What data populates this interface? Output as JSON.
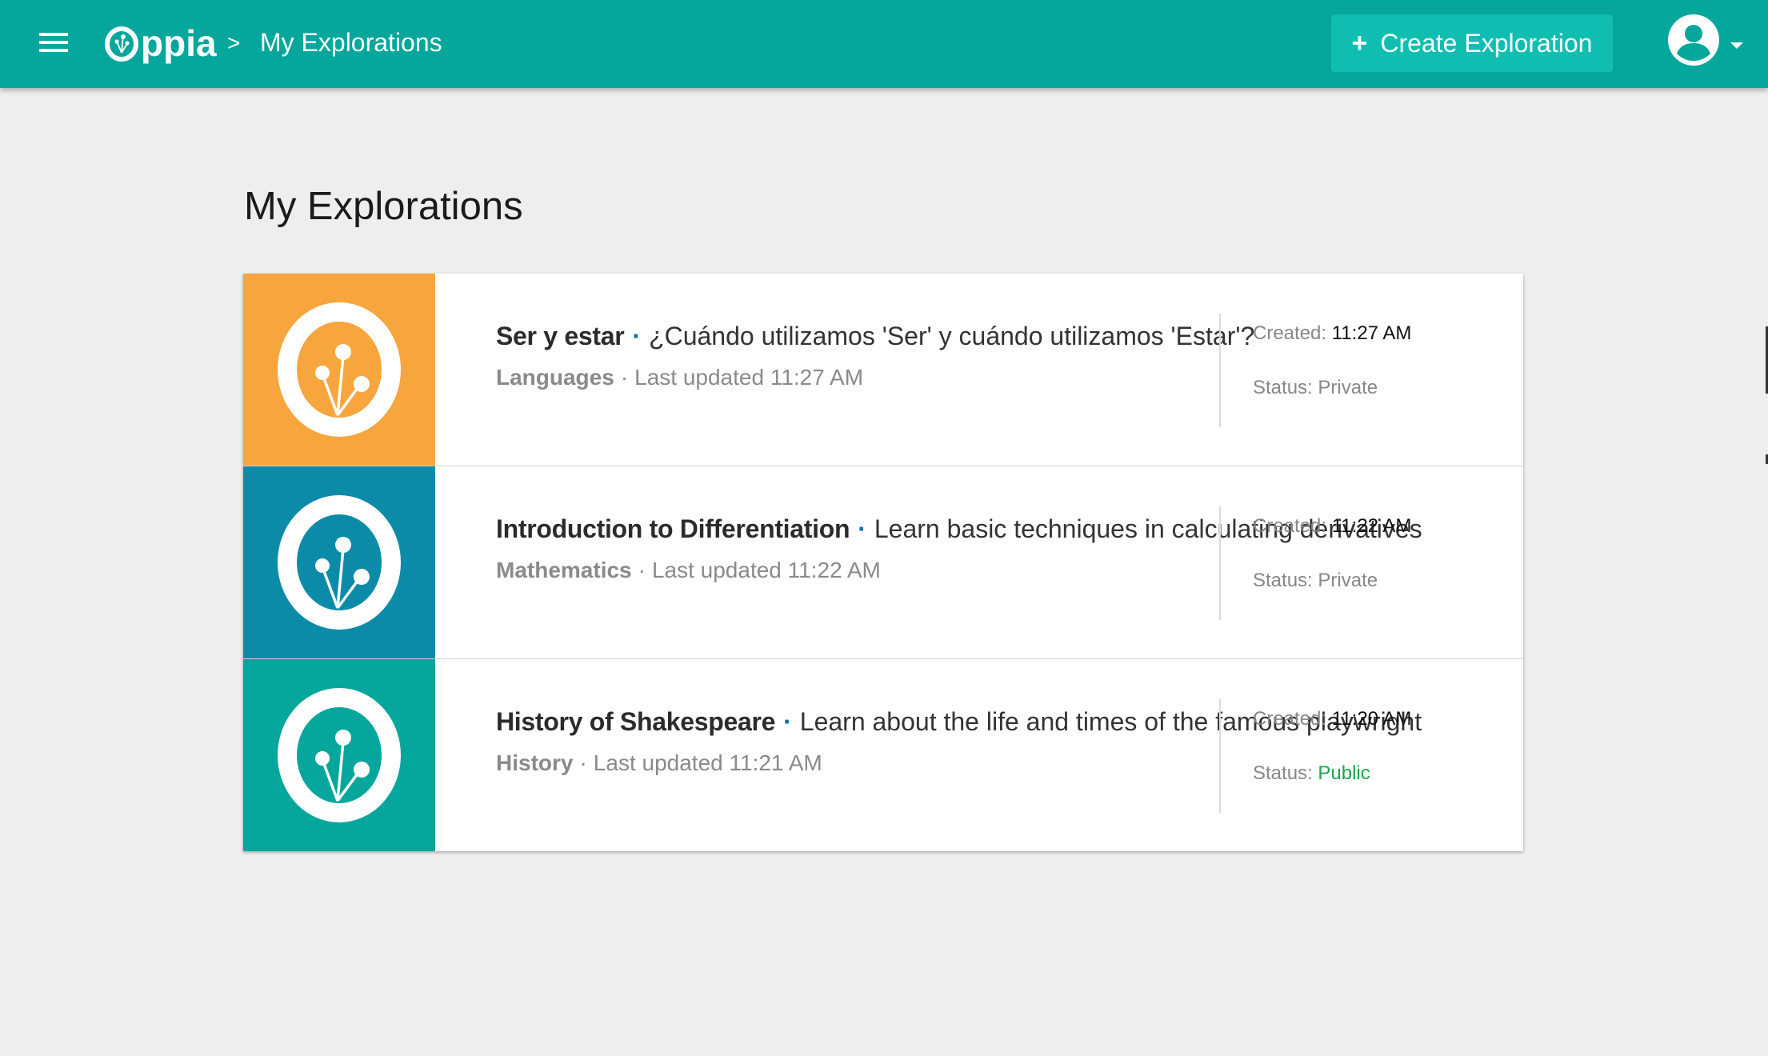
{
  "header": {
    "logo_text": "ppia",
    "breadcrumb_separator": ">",
    "breadcrumb_title": "My Explorations",
    "create_button_plus": "+",
    "create_button_label": "Create Exploration"
  },
  "page": {
    "title": "My Explorations"
  },
  "colors": {
    "topbar": "#05a69b",
    "create_button": "#10beb1",
    "thumb_languages": "#f6a63d",
    "thumb_mathematics": "#0c8ba8",
    "thumb_history": "#05a69b",
    "status_public": "#1aa44a"
  },
  "explorations": [
    {
      "title": "Ser y estar",
      "separator": "·",
      "objective": "¿Cuándo utilizamos 'Ser' y cuándo utilizamos 'Estar'?",
      "category": "Languages",
      "meta_separator": "·",
      "last_updated": "Last updated 11:27 AM",
      "created_label": "Created:",
      "created_value": "11:27 AM",
      "status_label": "Status:",
      "status_value": "Private"
    },
    {
      "title": "Introduction to Differentiation",
      "separator": "·",
      "objective": "Learn basic techniques in calculating derivatives",
      "category": "Mathematics",
      "meta_separator": "·",
      "last_updated": "Last updated 11:22 AM",
      "created_label": "Created:",
      "created_value": "11:22 AM",
      "status_label": "Status:",
      "status_value": "Private"
    },
    {
      "title": "History of Shakespeare",
      "separator": "·",
      "objective": "Learn about the life and times of the famous playwright",
      "category": "History",
      "meta_separator": "·",
      "last_updated": "Last updated 11:21 AM",
      "created_label": "Created:",
      "created_value": "11:20 AM",
      "status_label": "Status:",
      "status_value": "Public"
    }
  ]
}
